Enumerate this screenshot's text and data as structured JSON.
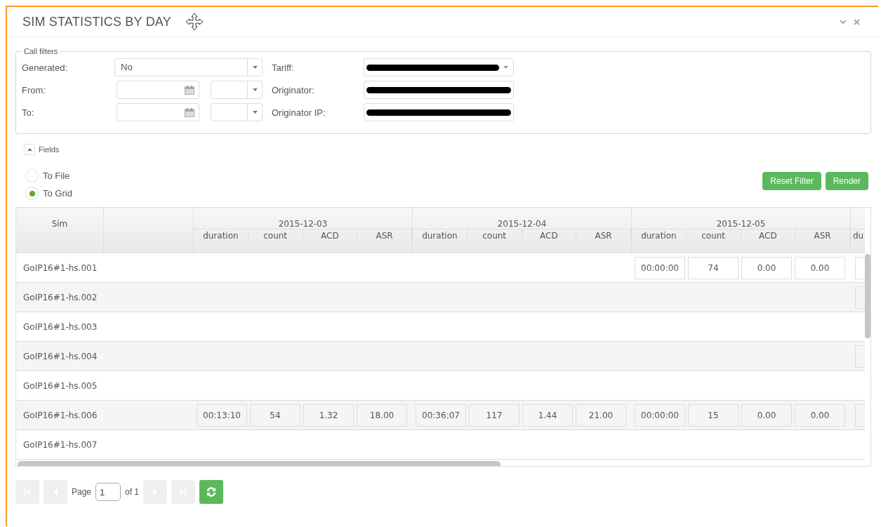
{
  "window": {
    "title": "SIM STATISTICS BY DAY"
  },
  "filters": {
    "legend": "Call filters",
    "left": [
      {
        "label": "Generated:",
        "kind": "select",
        "value": "No"
      },
      {
        "label": "From:",
        "kind": "datetime"
      },
      {
        "label": "To:",
        "kind": "datetime"
      }
    ],
    "right": [
      {
        "label": "Tariff:",
        "kind": "select"
      },
      {
        "label": "Originator:",
        "kind": "text"
      },
      {
        "label": "Originator IP:",
        "kind": "text"
      }
    ]
  },
  "fields_toggle": {
    "label": "Fields",
    "expanded": true
  },
  "output": [
    {
      "label": "To File",
      "selected": false
    },
    {
      "label": "To Grid",
      "selected": true
    }
  ],
  "buttons": [
    "Reset Filter",
    "Render"
  ],
  "grid": {
    "sim_header": "Sim",
    "days": [
      {
        "date": "2015-12-03",
        "subcolumns": [
          "duration",
          "count",
          "ACD",
          "ASR"
        ]
      },
      {
        "date": "2015-12-04",
        "subcolumns": [
          "duration",
          "count",
          "ACD",
          "ASR"
        ]
      },
      {
        "date": "2015-12-05",
        "subcolumns": [
          "duration",
          "count",
          "ACD",
          "ASR"
        ]
      }
    ],
    "cut_subheader": "du",
    "rows": [
      {
        "sim": "GoIP16#1-hs.001",
        "cut_cell": true,
        "days": [
          {
            "kind": "blank"
          },
          {
            "kind": "blank"
          },
          {
            "kind": "values",
            "values": [
              "00:00:00",
              "74",
              "0.00",
              "0.00"
            ]
          }
        ]
      },
      {
        "sim": "GoIP16#1-hs.002",
        "cut_cell": true,
        "days": [
          {
            "kind": "blank"
          },
          {
            "kind": "blank"
          },
          {
            "kind": "blank"
          }
        ]
      },
      {
        "sim": "GoIP16#1-hs.003",
        "cut_cell": false,
        "days": [
          {
            "kind": "blank"
          },
          {
            "kind": "blank"
          },
          {
            "kind": "blank"
          }
        ]
      },
      {
        "sim": "GoIP16#1-hs.004",
        "cut_cell": true,
        "days": [
          {
            "kind": "blank"
          },
          {
            "kind": "blank"
          },
          {
            "kind": "blank"
          }
        ]
      },
      {
        "sim": "GoIP16#1-hs.005",
        "cut_cell": false,
        "days": [
          {
            "kind": "blank"
          },
          {
            "kind": "blank"
          },
          {
            "kind": "blank"
          }
        ]
      },
      {
        "sim": "GoIP16#1-hs.006",
        "cut_cell": true,
        "days": [
          {
            "kind": "values",
            "values": [
              "00:13:10",
              "54",
              "1.32",
              "18.00"
            ]
          },
          {
            "kind": "values",
            "values": [
              "00:36:07",
              "117",
              "1.44",
              "21.00"
            ]
          },
          {
            "kind": "values",
            "values": [
              "00:00:00",
              "15",
              "0.00",
              "0.00"
            ]
          }
        ]
      },
      {
        "sim": "GoIP16#1-hs.007",
        "cut_cell": false,
        "days": [
          {
            "kind": "blank"
          },
          {
            "kind": "blank"
          },
          {
            "kind": "blank"
          }
        ]
      }
    ]
  },
  "pager": {
    "page_label": "Page",
    "page": "1",
    "of_label": "of 1"
  }
}
